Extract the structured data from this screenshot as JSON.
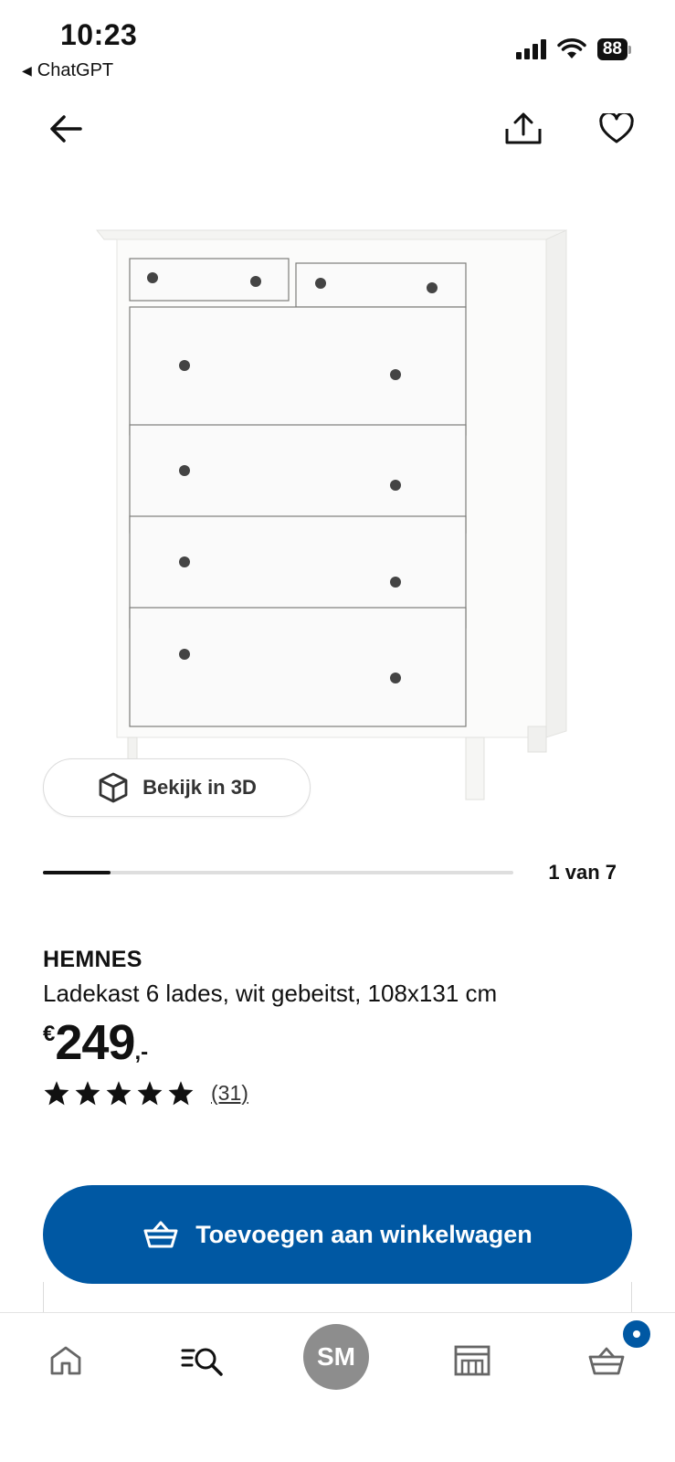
{
  "status_bar": {
    "time": "10:23",
    "back_app": "ChatGPT",
    "battery": "88"
  },
  "nav": {
    "back_icon": "arrow-left-icon",
    "share_icon": "share-icon",
    "favorite_icon": "heart-icon"
  },
  "gallery": {
    "view_3d_label": "Bekijk in 3D",
    "pager_text": "1 van 7",
    "current_index": 1,
    "total": 7
  },
  "product": {
    "brand": "HEMNES",
    "description": "Ladekast 6 lades, wit gebeitst, 108x131 cm",
    "price_currency": "€",
    "price_amount": "249",
    "price_decimals": ",-",
    "rating": 5,
    "review_count": "(31)"
  },
  "cta": {
    "add_to_cart_label": "Toevoegen aan winkelwagen",
    "icon": "basket-icon"
  },
  "tabbar": {
    "home_icon": "home-icon",
    "search_icon": "search-menu-icon",
    "profile_initials": "SM",
    "store_icon": "store-icon",
    "cart_icon": "basket-icon"
  },
  "colors": {
    "brand_blue": "#0058a3",
    "profile_gray": "#8d8d8d"
  }
}
